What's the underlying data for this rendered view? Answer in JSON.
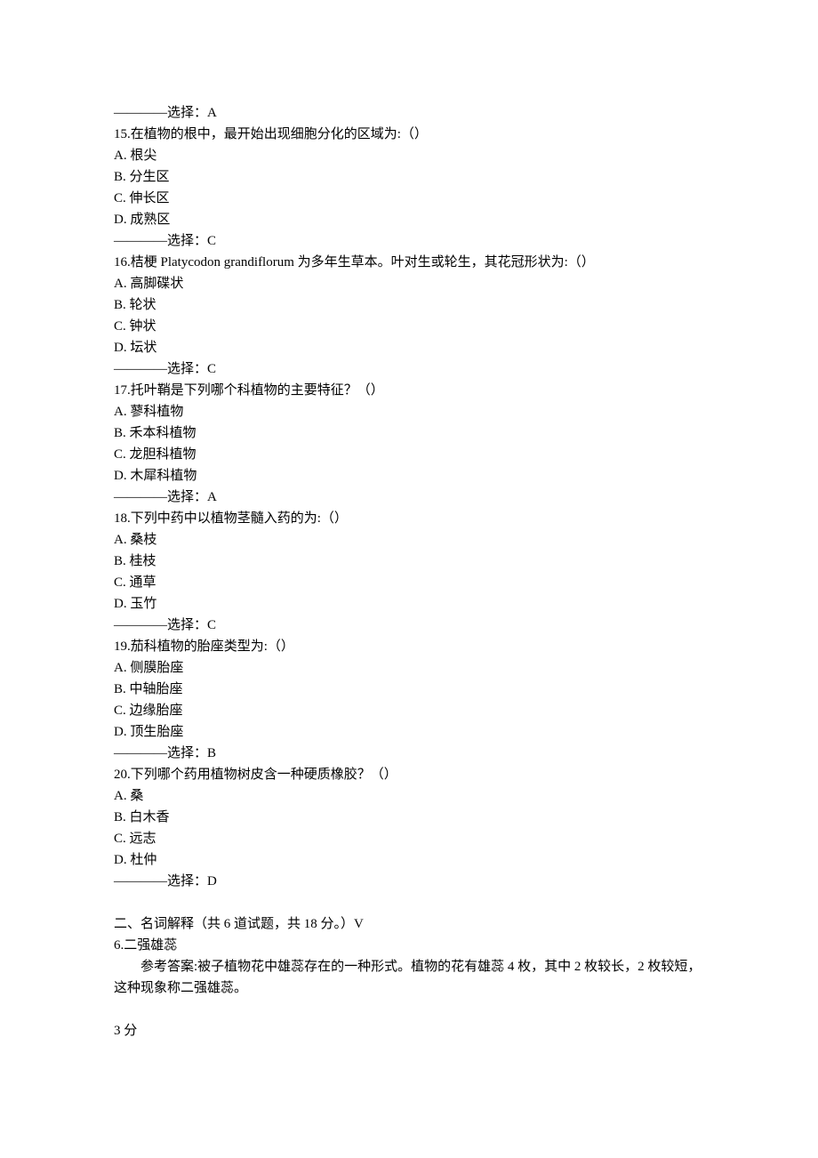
{
  "q14_answer": "————选择：A",
  "q15": {
    "stem": "15.在植物的根中，最开始出现细胞分化的区域为:（）",
    "a": "A. 根尖",
    "b": "B. 分生区",
    "c": "C. 伸长区",
    "d": "D. 成熟区",
    "answer": "————选择：C"
  },
  "q16": {
    "stem": "16.桔梗 Platycodon grandiflorum 为多年生草本。叶对生或轮生，其花冠形状为:（）",
    "a": "A. 高脚碟状",
    "b": "B. 轮状",
    "c": "C. 钟状",
    "d": "D. 坛状",
    "answer": "————选择：C"
  },
  "q17": {
    "stem": "17.托叶鞘是下列哪个科植物的主要特征？（）",
    "a": "A. 蓼科植物",
    "b": "B. 禾本科植物",
    "c": "C. 龙胆科植物",
    "d": "D. 木犀科植物",
    "answer": "————选择：A"
  },
  "q18": {
    "stem": "18.下列中药中以植物茎髓入药的为:（）",
    "a": "A. 桑枝",
    "b": "B. 桂枝",
    "c": "C. 通草",
    "d": "D. 玉竹",
    "answer": "————选择：C"
  },
  "q19": {
    "stem": "19.茄科植物的胎座类型为:（）",
    "a": "A. 侧膜胎座",
    "b": "B. 中轴胎座",
    "c": "C. 边缘胎座",
    "d": "D. 顶生胎座",
    "answer": "————选择：B"
  },
  "q20": {
    "stem": "20.下列哪个药用植物树皮含一种硬质橡胶？（）",
    "a": "A. 桑",
    "b": "B. 白木香",
    "c": "C. 远志",
    "d": "D. 杜仲",
    "answer": "————选择：D"
  },
  "section2": {
    "header": "二、名词解释（共 6 道试题，共 18 分。）V",
    "term6": "6.二强雄蕊",
    "term6_answer": "参考答案:被子植物花中雄蕊存在的一种形式。植物的花有雄蕊 4 枚，其中 2 枚较长，2 枚较短，这种现象称二强雄蕊。",
    "points": "3 分"
  }
}
